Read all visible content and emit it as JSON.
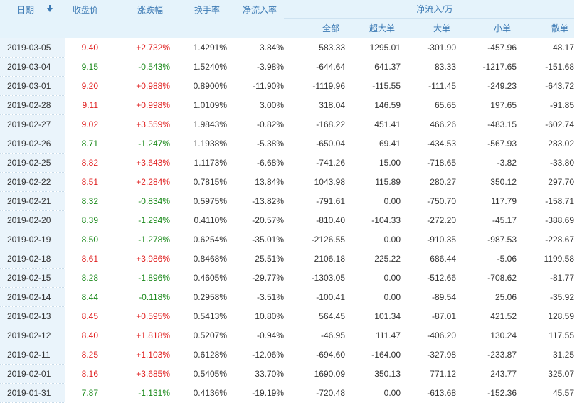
{
  "header": {
    "date": "日期",
    "close": "收盘价",
    "change_pct": "涨跌幅",
    "turnover": "换手率",
    "net_inflow_rate": "净流入率",
    "net_inflow_group": "净流入/万",
    "total": "全部",
    "super_large": "超大单",
    "large": "大单",
    "small": "小单",
    "retail": "散单"
  },
  "rows": [
    {
      "date": "2019-03-05",
      "close": "9.40",
      "chg": "+2.732%",
      "turnover": "1.4291%",
      "rate": "3.84%",
      "total": "583.33",
      "super": "1295.01",
      "large": "-301.90",
      "small": "-457.96",
      "retail": "48.17",
      "dir": "up"
    },
    {
      "date": "2019-03-04",
      "close": "9.15",
      "chg": "-0.543%",
      "turnover": "1.5240%",
      "rate": "-3.98%",
      "total": "-644.64",
      "super": "641.37",
      "large": "83.33",
      "small": "-1217.65",
      "retail": "-151.68",
      "dir": "down"
    },
    {
      "date": "2019-03-01",
      "close": "9.20",
      "chg": "+0.988%",
      "turnover": "0.8900%",
      "rate": "-11.90%",
      "total": "-1119.96",
      "super": "-115.55",
      "large": "-111.45",
      "small": "-249.23",
      "retail": "-643.72",
      "dir": "up"
    },
    {
      "date": "2019-02-28",
      "close": "9.11",
      "chg": "+0.998%",
      "turnover": "1.0109%",
      "rate": "3.00%",
      "total": "318.04",
      "super": "146.59",
      "large": "65.65",
      "small": "197.65",
      "retail": "-91.85",
      "dir": "up"
    },
    {
      "date": "2019-02-27",
      "close": "9.02",
      "chg": "+3.559%",
      "turnover": "1.9843%",
      "rate": "-0.82%",
      "total": "-168.22",
      "super": "451.41",
      "large": "466.26",
      "small": "-483.15",
      "retail": "-602.74",
      "dir": "up"
    },
    {
      "date": "2019-02-26",
      "close": "8.71",
      "chg": "-1.247%",
      "turnover": "1.1938%",
      "rate": "-5.38%",
      "total": "-650.04",
      "super": "69.41",
      "large": "-434.53",
      "small": "-567.93",
      "retail": "283.02",
      "dir": "down"
    },
    {
      "date": "2019-02-25",
      "close": "8.82",
      "chg": "+3.643%",
      "turnover": "1.1173%",
      "rate": "-6.68%",
      "total": "-741.26",
      "super": "15.00",
      "large": "-718.65",
      "small": "-3.82",
      "retail": "-33.80",
      "dir": "up"
    },
    {
      "date": "2019-02-22",
      "close": "8.51",
      "chg": "+2.284%",
      "turnover": "0.7815%",
      "rate": "13.84%",
      "total": "1043.98",
      "super": "115.89",
      "large": "280.27",
      "small": "350.12",
      "retail": "297.70",
      "dir": "up"
    },
    {
      "date": "2019-02-21",
      "close": "8.32",
      "chg": "-0.834%",
      "turnover": "0.5975%",
      "rate": "-13.82%",
      "total": "-791.61",
      "super": "0.00",
      "large": "-750.70",
      "small": "117.79",
      "retail": "-158.71",
      "dir": "down"
    },
    {
      "date": "2019-02-20",
      "close": "8.39",
      "chg": "-1.294%",
      "turnover": "0.4110%",
      "rate": "-20.57%",
      "total": "-810.40",
      "super": "-104.33",
      "large": "-272.20",
      "small": "-45.17",
      "retail": "-388.69",
      "dir": "down"
    },
    {
      "date": "2019-02-19",
      "close": "8.50",
      "chg": "-1.278%",
      "turnover": "0.6254%",
      "rate": "-35.01%",
      "total": "-2126.55",
      "super": "0.00",
      "large": "-910.35",
      "small": "-987.53",
      "retail": "-228.67",
      "dir": "down"
    },
    {
      "date": "2019-02-18",
      "close": "8.61",
      "chg": "+3.986%",
      "turnover": "0.8468%",
      "rate": "25.51%",
      "total": "2106.18",
      "super": "225.22",
      "large": "686.44",
      "small": "-5.06",
      "retail": "1199.58",
      "dir": "up"
    },
    {
      "date": "2019-02-15",
      "close": "8.28",
      "chg": "-1.896%",
      "turnover": "0.4605%",
      "rate": "-29.77%",
      "total": "-1303.05",
      "super": "0.00",
      "large": "-512.66",
      "small": "-708.62",
      "retail": "-81.77",
      "dir": "down"
    },
    {
      "date": "2019-02-14",
      "close": "8.44",
      "chg": "-0.118%",
      "turnover": "0.2958%",
      "rate": "-3.51%",
      "total": "-100.41",
      "super": "0.00",
      "large": "-89.54",
      "small": "25.06",
      "retail": "-35.92",
      "dir": "down"
    },
    {
      "date": "2019-02-13",
      "close": "8.45",
      "chg": "+0.595%",
      "turnover": "0.5413%",
      "rate": "10.80%",
      "total": "564.45",
      "super": "101.34",
      "large": "-87.01",
      "small": "421.52",
      "retail": "128.59",
      "dir": "up"
    },
    {
      "date": "2019-02-12",
      "close": "8.40",
      "chg": "+1.818%",
      "turnover": "0.5207%",
      "rate": "-0.94%",
      "total": "-46.95",
      "super": "111.47",
      "large": "-406.20",
      "small": "130.24",
      "retail": "117.55",
      "dir": "up"
    },
    {
      "date": "2019-02-11",
      "close": "8.25",
      "chg": "+1.103%",
      "turnover": "0.6128%",
      "rate": "-12.06%",
      "total": "-694.60",
      "super": "-164.00",
      "large": "-327.98",
      "small": "-233.87",
      "retail": "31.25",
      "dir": "up"
    },
    {
      "date": "2019-02-01",
      "close": "8.16",
      "chg": "+3.685%",
      "turnover": "0.5405%",
      "rate": "33.70%",
      "total": "1690.09",
      "super": "350.13",
      "large": "771.12",
      "small": "243.77",
      "retail": "325.07",
      "dir": "up"
    },
    {
      "date": "2019-01-31",
      "close": "7.87",
      "chg": "-1.131%",
      "turnover": "0.4136%",
      "rate": "-19.19%",
      "total": "-720.48",
      "super": "0.00",
      "large": "-613.68",
      "small": "-152.36",
      "retail": "45.57",
      "dir": "down"
    }
  ],
  "colors": {
    "up": "#e02020",
    "down": "#1c8a1c",
    "header_bg": "#e5f3fb",
    "header_text": "#3c7ab4"
  },
  "icons": {
    "sort": "sort-down-arrow-icon"
  }
}
